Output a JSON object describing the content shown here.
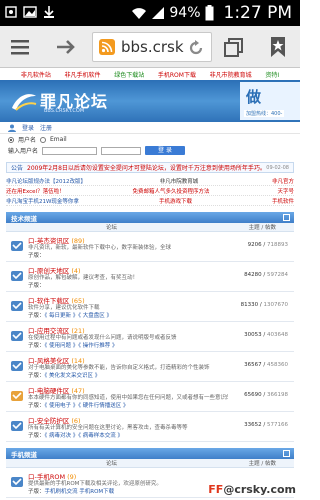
{
  "status_bar": {
    "battery_percent": "94%",
    "time": "1:27 PM",
    "icons": [
      "usb-debug-icon",
      "image-icon",
      "download-icon",
      "wifi-icon",
      "signal-icon",
      "battery-icon"
    ]
  },
  "browser": {
    "url": "bbs.crsk",
    "icons": [
      "menu-icon",
      "forward-arrow-icon",
      "rss-icon",
      "reload-icon",
      "tabs-icon",
      "bookmark-icon"
    ],
    "tabs_count": "1"
  },
  "top_nav": [
    "非凡软件站",
    "非凡手机软件",
    "绿色下载站",
    "手机ROM下载",
    "非凡市院教育城",
    "资特I"
  ],
  "banner": {
    "logo_text": "罪凡论坛",
    "logo_sub": "BBS.CRSKY.COM",
    "ad_text": "做",
    "ad_small": "加盟热线：400-"
  },
  "login": {
    "links": [
      "登录",
      "注册"
    ],
    "radio_options": [
      "用户名",
      "Email"
    ],
    "input_label": "输入用户名",
    "login_button": "登 录"
  },
  "notice": {
    "label": "公告",
    "text": "2009年2月8日以后请勿设置安全提问才可登陆论坛，设置时千万注意到使用场所年手巧。",
    "date": "09-02-08"
  },
  "links": [
    [
      "非凡论坛版规办法【2012改版】",
      "非凡市院教育城",
      "非凡官方"
    ],
    [
      "还在用Excel？落伍啦！",
      "免费邮箱人气多久投资程序方法",
      "天字号"
    ],
    [
      "非凡淘宝手机21W现金等你拿",
      "手机游戏下载",
      "手机软件"
    ]
  ],
  "sections": [
    {
      "title": "技术频道",
      "col_forum": "论坛",
      "col_stats": "主题 / 帖数",
      "forums": [
        {
          "name": "口-英杰资讯区",
          "count": "(89)",
          "desc": "非凡资讯，新软，最新软件下载中心，数字新装体验，全球",
          "sub_label": "子版：",
          "subs": "",
          "stats": "9206",
          "posts": "718893"
        },
        {
          "name": "口-原创天地区",
          "count": "(4)",
          "desc": "原创作品，解包破解，建议考查，有奖互动！",
          "sub_label": "子版：",
          "subs": "",
          "stats": "84280",
          "posts": "597284"
        },
        {
          "name": "口-软件下载区",
          "count": "(65)",
          "desc": "软件分享，建议优化软件下载",
          "sub_label": "子版：",
          "subs": "《 每日更新 》《 大盘盘区 》",
          "stats": "81330",
          "posts": "1307670"
        },
        {
          "name": "口-应用交流区",
          "count": "(21)",
          "desc": "在使用过程中有问题或者发现什么问题，请说明版号或者反馈",
          "sub_label": "子版：",
          "subs": "《 使用问题 》《 操作行推荐 》",
          "stats": "30053",
          "posts": "403648"
        },
        {
          "name": "口-风格美化区",
          "count": "(14)",
          "desc": "对于电脑桌面的美化等参数不能，告诉你自定义格式，打造精彩的个性装饰",
          "sub_label": "子版：",
          "subs": "《 美化发文采交识区 》",
          "stats": "36567",
          "posts": "458360"
        },
        {
          "name": "口-电脑硬件区",
          "count": "(47)",
          "desc": "本本硬件方面都有你的同感知道，使用中如果您在任何问题，又或者想有一些意识的同感体会",
          "sub_label": "子版：",
          "subs": "《 使用电子 》《 硬件行情播送区 》",
          "stats": "65690",
          "posts": "366198"
        },
        {
          "name": "口-安全防护区",
          "count": "(6)",
          "desc": "所有有关计算机的安全问题在这里讨论，黑客攻击，查毒杀毒等等",
          "sub_label": "子版：",
          "subs": "《 病毒对决 》《 病毒样本交流 》",
          "stats": "33652",
          "posts": "577166"
        }
      ]
    },
    {
      "title": "手机频道",
      "col_forum": "论坛",
      "col_stats": "主题 / 帖数",
      "forums": [
        {
          "name": "口-手机ROM",
          "count": "(9)",
          "desc": "提供最新的手机ROM下载及相关评论，欢迎原创研究。",
          "sub_label": "子版：",
          "subs": "手机刷机交流 手机ROM下载",
          "stats": "",
          "posts": ""
        }
      ]
    }
  ],
  "watermark": {
    "prefix": "FF",
    "text": "@crsky.com"
  },
  "colors": {
    "accent_blue": "#3f7fc9",
    "forum_red": "#cc0000",
    "count_orange": "#f08c00",
    "link_blue": "#2457a8"
  }
}
